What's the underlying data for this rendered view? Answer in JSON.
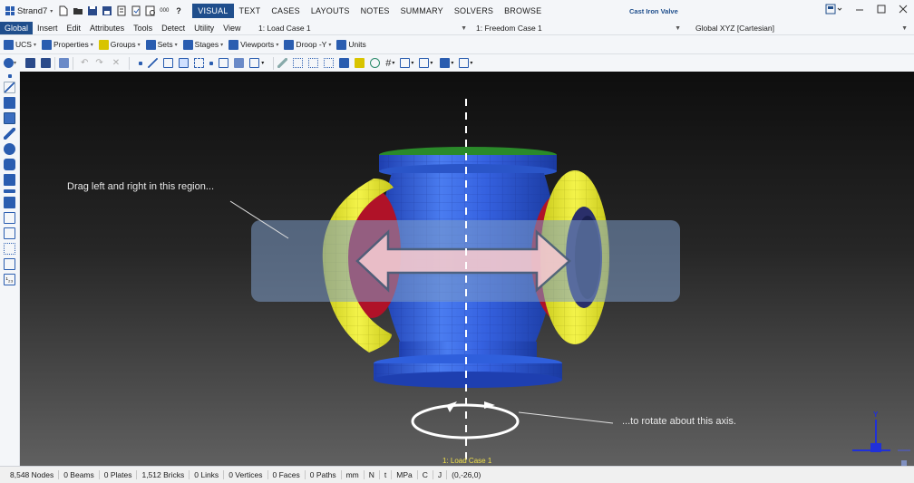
{
  "app": {
    "name": "Strand7",
    "document_title": "Cast Iron Valve",
    "quick_access": [
      "new-file-icon",
      "open-folder-icon",
      "save-icon",
      "save-all-icon",
      "report-icon",
      "print-icon",
      "check-icon",
      "numbering-icon",
      "help-icon"
    ],
    "help_label": "?",
    "numbering_label": "000"
  },
  "ribbon_tabs": [
    {
      "label": "VISUAL",
      "active": true
    },
    {
      "label": "TEXT",
      "active": false
    },
    {
      "label": "CASES",
      "active": false
    },
    {
      "label": "LAYOUTS",
      "active": false
    },
    {
      "label": "NOTES",
      "active": false
    },
    {
      "label": "SUMMARY",
      "active": false
    },
    {
      "label": "SOLVERS",
      "active": false
    },
    {
      "label": "BROWSE",
      "active": false
    }
  ],
  "menu": [
    {
      "label": "Global",
      "active": true
    },
    {
      "label": "Insert",
      "active": false
    },
    {
      "label": "Edit",
      "active": false
    },
    {
      "label": "Attributes",
      "active": false
    },
    {
      "label": "Tools",
      "active": false
    },
    {
      "label": "Detect",
      "active": false
    },
    {
      "label": "Utility",
      "active": false
    },
    {
      "label": "View",
      "active": false
    }
  ],
  "combos": {
    "load_case": "1: Load Case 1",
    "freedom_case": "1: Freedom Case 1",
    "coord_sys": "Global XYZ [Cartesian]"
  },
  "toolbar1": [
    {
      "label": "UCS",
      "icon": "ucs-axes-icon",
      "color": "#2a5db0"
    },
    {
      "label": "Properties",
      "icon": "properties-grid-icon",
      "color": "#2a5db0"
    },
    {
      "label": "Groups",
      "icon": "groups-icon",
      "color": "#d8c400"
    },
    {
      "label": "Sets",
      "icon": "sets-icon",
      "color": "#2a5db0"
    },
    {
      "label": "Stages",
      "icon": "stages-icon",
      "color": "#2a5db0"
    },
    {
      "label": "Viewports",
      "icon": "viewports-icon",
      "color": "#2a5db0"
    },
    {
      "label": "Droop -Y",
      "icon": "droop-icon",
      "color": "#2a5db0"
    },
    {
      "label": "Units",
      "icon": "units-icon",
      "color": "#2a5db0"
    }
  ],
  "viewport": {
    "hint_drag": "Drag left and right in this region...",
    "hint_rotate": "...to rotate about this axis.",
    "load_case_label": "1: Load Case 1",
    "triad_label": "Y",
    "colors": {
      "body": "#2f5fdc",
      "flange": "#eeee30",
      "inner": "#b01228",
      "flange_top": "#3ec23e"
    }
  },
  "status": {
    "nodes": "8,548 Nodes",
    "beams": "0 Beams",
    "plates": "0 Plates",
    "bricks": "1,512 Bricks",
    "links": "0 Links",
    "vertices": "0 Vertices",
    "faces": "0 Faces",
    "paths": "0 Paths",
    "unit_length": "mm",
    "unit_force": "N",
    "unit_time": "t",
    "unit_stress": "MPa",
    "unit_temp": "C",
    "unit_energy": "J",
    "cursor": "(0,-26,0)"
  }
}
